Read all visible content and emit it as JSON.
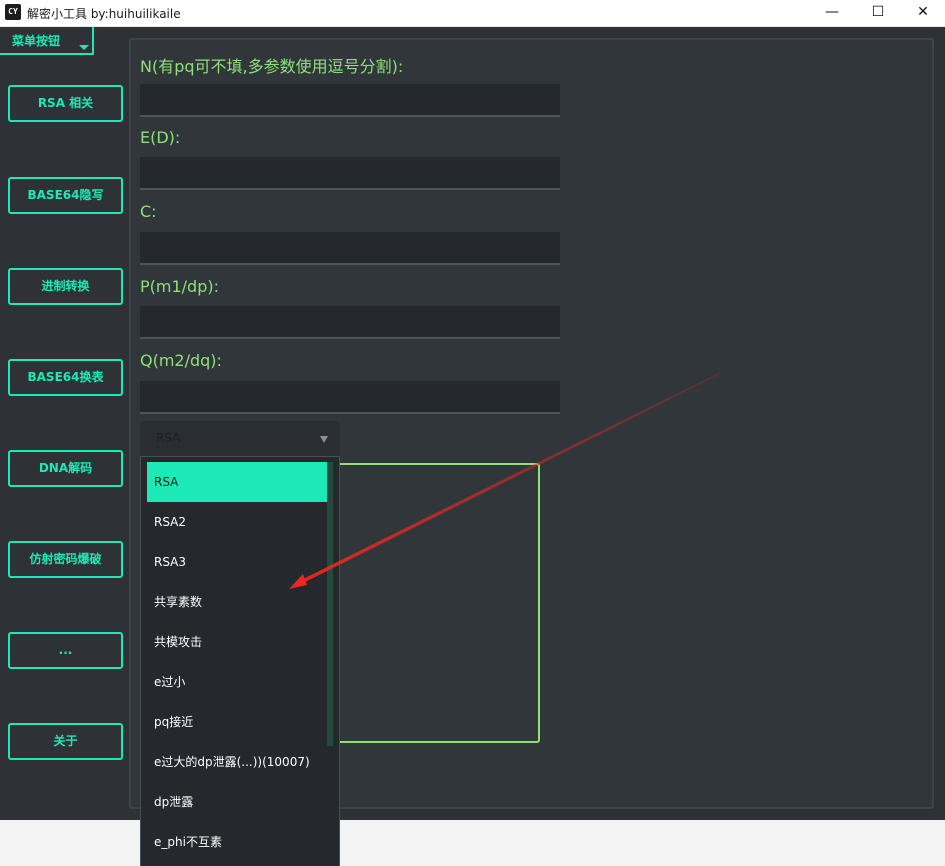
{
  "window": {
    "icon_text": "CY",
    "title": "解密小工具 by:huihuilikaile",
    "minimize": "—",
    "maximize": "☐",
    "close": "✕"
  },
  "menu": {
    "label": "菜单按钮"
  },
  "sidebar": {
    "items": [
      {
        "label": "RSA 相关"
      },
      {
        "label": "BASE64隐写"
      },
      {
        "label": "进制转换"
      },
      {
        "label": "BASE64换表"
      },
      {
        "label": "DNA解码"
      },
      {
        "label": "仿射密码爆破"
      },
      {
        "label": "..."
      },
      {
        "label": "关于"
      }
    ]
  },
  "form": {
    "n_label": "N(有pq可不填,多参数使用逗号分割):",
    "e_label": "E(D):",
    "c_label": "C:",
    "p_label": "P(m1/dp):",
    "q_label": "Q(m2/dq):",
    "n_value": "",
    "e_value": "",
    "c_value": "",
    "p_value": "",
    "q_value": ""
  },
  "mode_select": {
    "selected": "RSA",
    "options": [
      "RSA",
      "RSA2",
      "RSA3",
      "共享素数",
      "共模攻击",
      "e过小",
      "pq接近",
      "e过大的dp泄露(...))(10007)",
      "dp泄露",
      "e_phi不互素"
    ]
  },
  "colors": {
    "accent": "#1de9b6",
    "label_green": "#8ee07a",
    "background": "#31363b",
    "arrow": "#e8281e"
  }
}
